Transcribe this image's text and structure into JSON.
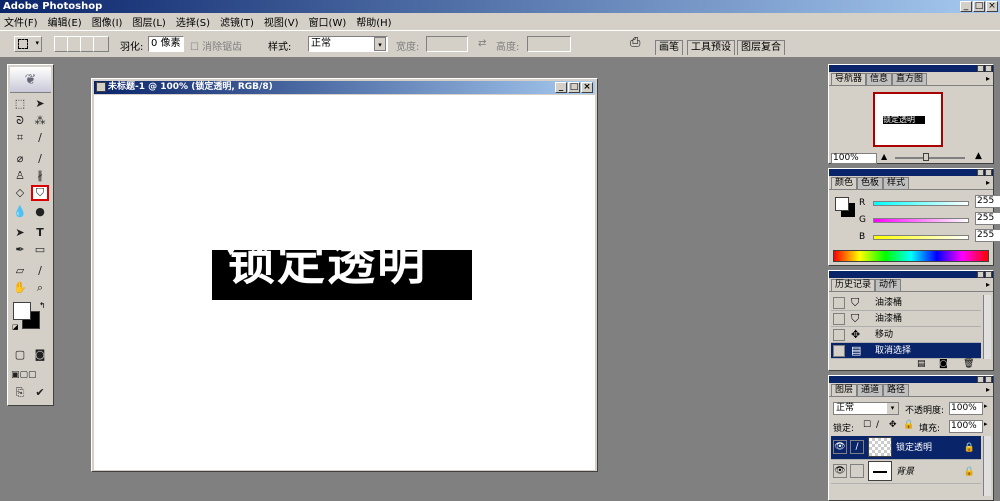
{
  "app": {
    "title": "Adobe Photoshop",
    "window_controls": [
      "_",
      "□",
      "×"
    ]
  },
  "menu": [
    "文件(F)",
    "编辑(E)",
    "图像(I)",
    "图层(L)",
    "选择(S)",
    "滤镜(T)",
    "视图(V)",
    "窗口(W)",
    "帮助(H)"
  ],
  "options": {
    "feather_label": "羽化:",
    "feather_value": "0 像素",
    "antialias_label": "消除锯齿",
    "style_label": "样式:",
    "style_value": "正常",
    "width_label": "宽度:",
    "height_label": "高度:",
    "swap_icon": "⇄",
    "well_tabs": [
      "画笔",
      "工具预设",
      "图层复合"
    ]
  },
  "document": {
    "title": "未标题-1 @ 100% (锁定透明, RGB/8)",
    "canvas_text": "锁定透明",
    "controls": [
      "_",
      "□",
      "×"
    ]
  },
  "navigator": {
    "tabs": [
      "导航器",
      "信息",
      "直方图"
    ],
    "thumb_text": "锁定透明",
    "zoom": "100%"
  },
  "color": {
    "tabs": [
      "颜色",
      "色板",
      "样式"
    ],
    "channels": [
      {
        "label": "R",
        "value": "255"
      },
      {
        "label": "G",
        "value": "255"
      },
      {
        "label": "B",
        "value": "255"
      }
    ]
  },
  "history": {
    "tabs": [
      "历史记录",
      "动作"
    ],
    "items": [
      {
        "icon": "⛉",
        "label": "油漆桶"
      },
      {
        "icon": "⛉",
        "label": "油漆桶"
      },
      {
        "icon": "✥",
        "label": "移动"
      },
      {
        "icon": "▤",
        "label": "取消选择"
      }
    ]
  },
  "layers": {
    "tabs": [
      "图层",
      "通道",
      "路径"
    ],
    "blend_mode": "正常",
    "opacity_label": "不透明度:",
    "opacity_value": "100%",
    "lock_label": "锁定:",
    "fill_label": "填充:",
    "fill_value": "100%",
    "items": [
      {
        "name": "锁定透明",
        "selected": true
      },
      {
        "name": "背景",
        "selected": false
      }
    ]
  },
  "colors": {
    "titlebar": "#0a246a",
    "chrome": "#d4d0c8",
    "workspace": "#808080",
    "tool_highlight": "#dd0000"
  }
}
